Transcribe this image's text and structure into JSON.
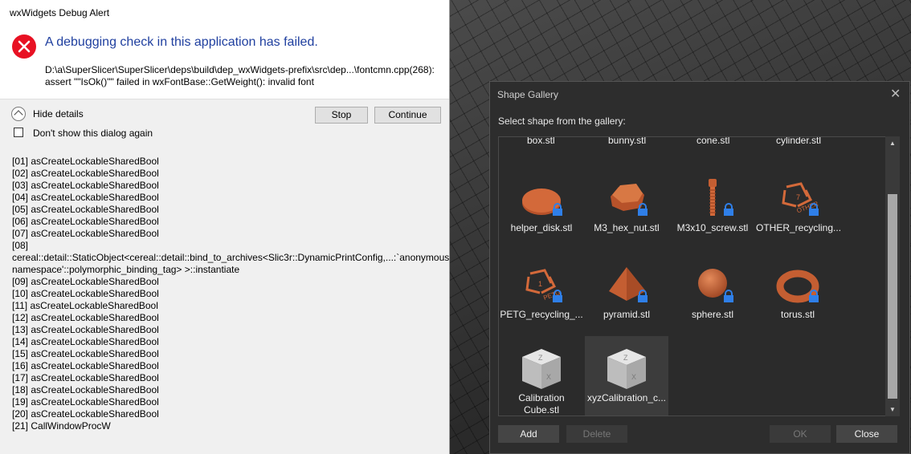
{
  "alert": {
    "title": "wxWidgets Debug Alert",
    "headline": "A debugging check in this application has failed.",
    "detail_line1": "D:\\a\\SuperSlicer\\SuperSlicer\\deps\\build\\dep_wxWidgets-prefix\\src\\dep...\\fontcmn.cpp(268):",
    "detail_line2": "assert \"\"IsOk()\"\" failed in wxFontBase::GetWeight(): invalid font",
    "hide_details": "Hide details",
    "dont_show": "Don't show this dialog again",
    "stop": "Stop",
    "continue": "Continue",
    "stack": [
      "[01] asCreateLockableSharedBool",
      "[02] asCreateLockableSharedBool",
      "[03] asCreateLockableSharedBool",
      "[04] asCreateLockableSharedBool",
      "[05] asCreateLockableSharedBool",
      "[06] asCreateLockableSharedBool",
      "[07] asCreateLockableSharedBool",
      "[08]",
      "cereal::detail::StaticObject<cereal::detail::bind_to_archives<Slic3r::DynamicPrintConfig,...:`anonymous namespace'::polymorphic_binding_tag> >::instantiate",
      "[09] asCreateLockableSharedBool",
      "[10] asCreateLockableSharedBool",
      "[11] asCreateLockableSharedBool",
      "[12] asCreateLockableSharedBool",
      "[13] asCreateLockableSharedBool",
      "[14] asCreateLockableSharedBool",
      "[15] asCreateLockableSharedBool",
      "[16] asCreateLockableSharedBool",
      "[17] asCreateLockableSharedBool",
      "[18] asCreateLockableSharedBool",
      "[19] asCreateLockableSharedBool",
      "[20] asCreateLockableSharedBool",
      "[21] CallWindowProcW"
    ]
  },
  "gallery": {
    "title": "Shape Gallery",
    "subtitle": "Select shape from the gallery:",
    "top_row": [
      "box.stl",
      "bunny.stl",
      "cone.stl",
      "cylinder.stl"
    ],
    "items": [
      {
        "label": "helper_disk.stl",
        "icon": "disk-icon",
        "locked": true
      },
      {
        "label": "M3_hex_nut.stl",
        "icon": "hex-nut-icon",
        "locked": true
      },
      {
        "label": "M3x10_screw.stl",
        "icon": "screw-icon",
        "locked": true
      },
      {
        "label": "OTHER_recycling...",
        "icon": "recycling-other-icon",
        "locked": true
      },
      {
        "label": "PETG_recycling_...",
        "icon": "recycling-petg-icon",
        "locked": true
      },
      {
        "label": "pyramid.stl",
        "icon": "pyramid-icon",
        "locked": true
      },
      {
        "label": "sphere.stl",
        "icon": "sphere-icon",
        "locked": true
      },
      {
        "label": "torus.stl",
        "icon": "torus-icon",
        "locked": true
      },
      {
        "label": "Calibration Cube.stl",
        "icon": "calibration-cube-icon",
        "locked": false
      },
      {
        "label": "xyzCalibration_c...",
        "icon": "xyz-cube-icon",
        "locked": false
      }
    ],
    "add": "Add",
    "delete": "Delete",
    "ok": "OK",
    "close": "Close",
    "accent": "#d3693a",
    "lock_color": "#2f7fe8"
  }
}
